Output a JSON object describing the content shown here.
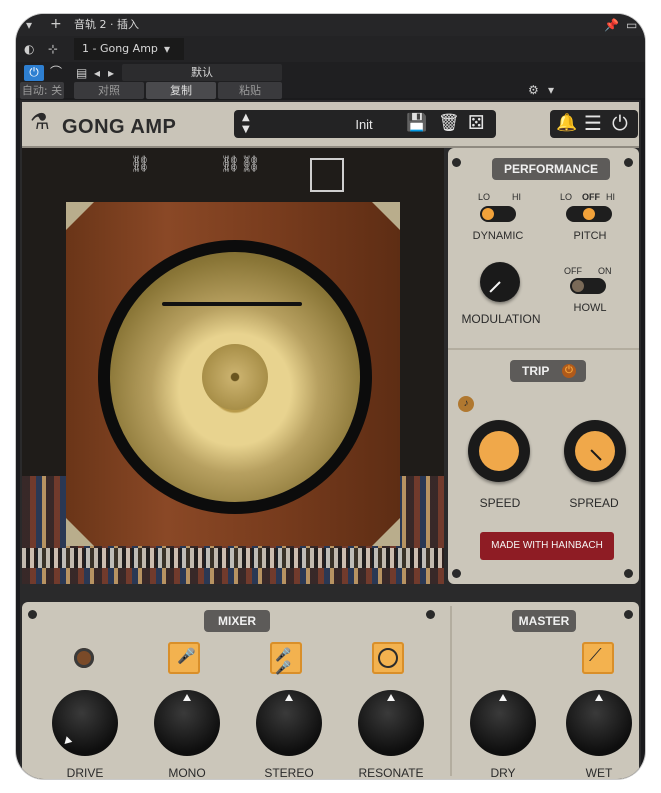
{
  "host": {
    "track_title": "音轨 2 · 插入",
    "plugin_tab": "1 - Gong Amp",
    "preset_default": "默认",
    "auto_label": "自动: 关",
    "compare_label": "对照",
    "copy_label": "复制",
    "paste_label": "粘贴"
  },
  "plugin": {
    "title": "GONG AMP",
    "preset_name": "Init"
  },
  "performance": {
    "header": "PERFORMANCE",
    "dynamic": {
      "lo": "LO",
      "hi": "HI",
      "label": "DYNAMIC"
    },
    "pitch": {
      "lo": "LO",
      "off": "OFF",
      "hi": "HI",
      "label": "PITCH"
    },
    "modulation_label": "MODULATION",
    "howl": {
      "off": "OFF",
      "on": "ON",
      "label": "HOWL"
    }
  },
  "trip": {
    "header": "TRIP",
    "speed_label": "SPEED",
    "spread_label": "SPREAD",
    "made_with": "MADE WITH HAINBACH"
  },
  "mixer": {
    "header": "MIXER",
    "knobs": [
      {
        "label": "DRIVE"
      },
      {
        "label": "MONO"
      },
      {
        "label": "STEREO"
      },
      {
        "label": "RESONATE"
      }
    ]
  },
  "master": {
    "header": "MASTER",
    "knobs": [
      {
        "label": "DRY"
      },
      {
        "label": "WET"
      }
    ]
  },
  "icons": {
    "flask": "flask-icon",
    "save": "save-icon",
    "trash": "trash-icon",
    "dice": "dice-icon",
    "bell": "bell-icon",
    "menu": "menu-icon",
    "power": "power-icon"
  },
  "colors": {
    "accent": "#f0a84a",
    "panel": "#cbc6ba",
    "dark": "#232324",
    "red": "#8e1c24"
  }
}
